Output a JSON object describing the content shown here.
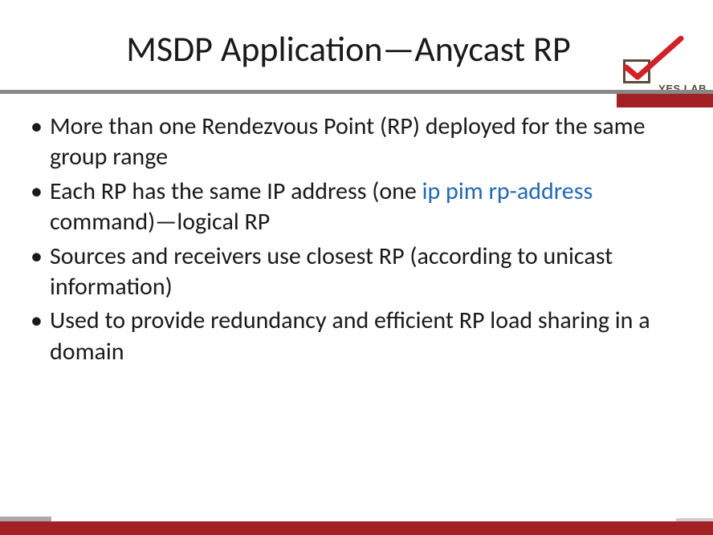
{
  "title": "MSDP Application—Anycast RP",
  "logo": {
    "text": "YES LAB",
    "icon_name": "checkbox-checkmark-icon"
  },
  "bullets": [
    {
      "parts": [
        {
          "text": "More than one Rendezvous Point (RP) deployed for the same group range",
          "code": false
        }
      ]
    },
    {
      "parts": [
        {
          "text": "Each RP has the same IP address (one ",
          "code": false
        },
        {
          "text": "ip pim rp-address",
          "code": true
        },
        {
          "text": " command)—logical RP",
          "code": false
        }
      ]
    },
    {
      "parts": [
        {
          "text": "Sources and receivers use closest RP (according to unicast information)",
          "code": false
        }
      ]
    },
    {
      "parts": [
        {
          "text": "Used to provide redundancy and efficient RP load sharing in a domain",
          "code": false
        }
      ]
    }
  ]
}
